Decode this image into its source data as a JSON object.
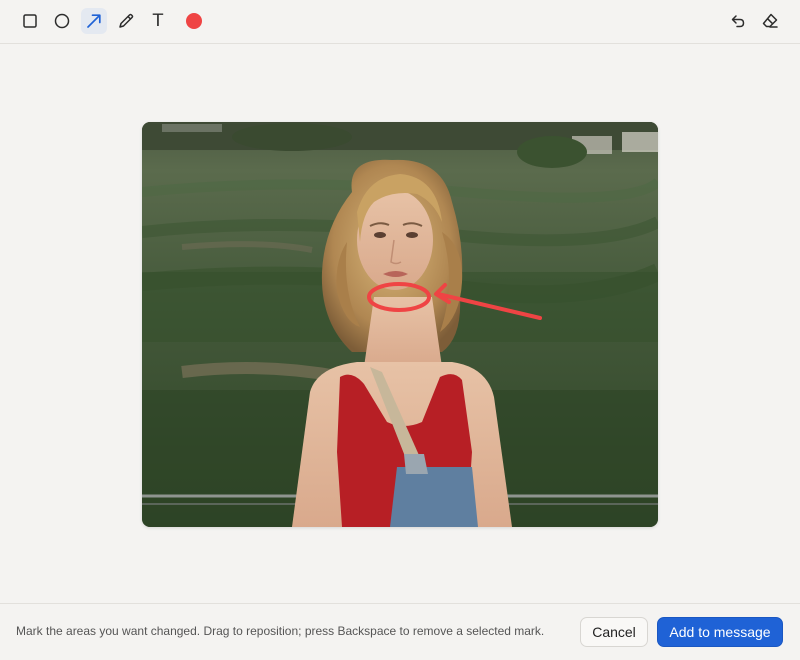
{
  "toolbar": {
    "tools": [
      {
        "name": "rectangle",
        "icon": "square-icon",
        "active": false
      },
      {
        "name": "ellipse",
        "icon": "circle-icon",
        "active": false
      },
      {
        "name": "arrow",
        "icon": "arrow-icon",
        "active": true
      },
      {
        "name": "pen",
        "icon": "pencil-icon",
        "active": false
      },
      {
        "name": "text",
        "icon": "text-icon",
        "glyph": "T",
        "active": false
      },
      {
        "name": "color",
        "icon": "color-swatch",
        "color": "#ef4444"
      }
    ],
    "right_tools": [
      {
        "name": "undo",
        "icon": "undo-icon"
      },
      {
        "name": "clear",
        "icon": "eraser-icon"
      }
    ],
    "active_color": "#1f62d6"
  },
  "canvas": {
    "annotation_color": "#ef4444",
    "annotations": [
      {
        "type": "ellipse"
      },
      {
        "type": "arrow"
      }
    ]
  },
  "footer": {
    "hint": "Mark the areas you want changed. Drag to reposition; press Backspace to remove a selected mark.",
    "cancel_label": "Cancel",
    "add_label": "Add to message"
  }
}
